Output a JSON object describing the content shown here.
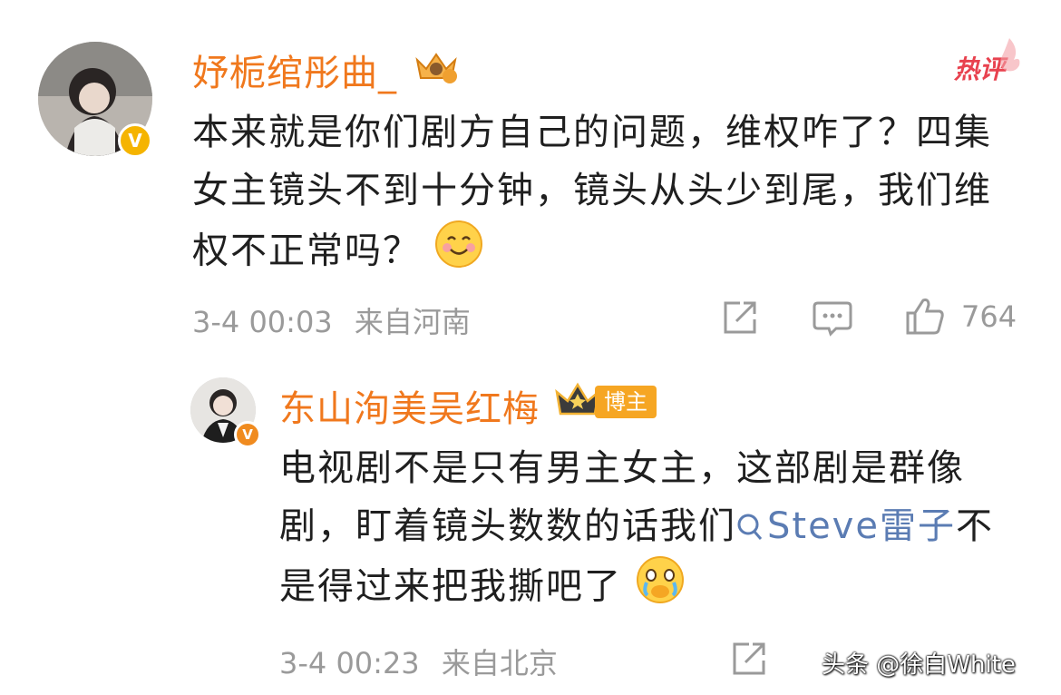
{
  "comment1": {
    "username": "妤栀绾彤曲_",
    "hot_label": "热评",
    "text": "本来就是你们剧方自己的问题，维权咋了？四集女主镜头不到十分钟，镜头从头少到尾，我们维权不正常吗？",
    "emoji": "smile-emoji",
    "time": "3-4 00:03",
    "location": "来自河南",
    "like_count": "764",
    "icons": [
      "share-icon",
      "comment-icon",
      "like-icon"
    ]
  },
  "reply": {
    "username": "东山洵美吴红梅",
    "tag": "博主",
    "text_before": "电视剧不是只有男主女主，这部剧是群像剧，盯着镜头数数的话我们",
    "mention": "Steve雷子",
    "text_after": "不是得过来把我撕吧了",
    "emoji": "crying-emoji",
    "time": "3-4 00:23",
    "location": "来自北京"
  },
  "watermark": "头条 @徐白White",
  "colors": {
    "username": "#f0781d",
    "meta": "#9a9a9a",
    "mention": "#5b7cb3",
    "hot": "#e8424f"
  }
}
